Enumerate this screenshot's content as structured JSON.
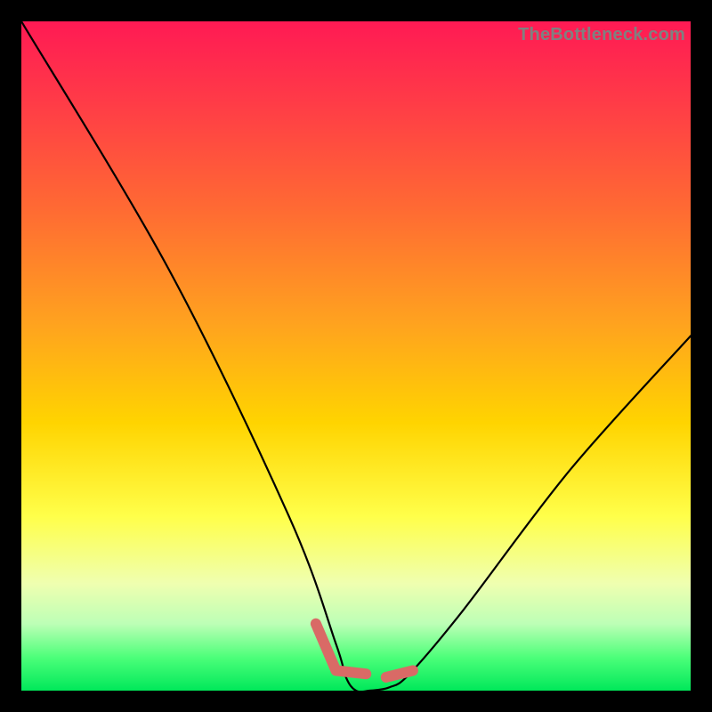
{
  "attribution": "TheBottleneck.com",
  "chart_data": {
    "type": "line",
    "title": "",
    "xlabel": "",
    "ylabel": "",
    "xlim": [
      0,
      100
    ],
    "ylim": [
      0,
      100
    ],
    "series": [
      {
        "name": "curve",
        "values": [
          {
            "x": 0.0,
            "y": 100.0
          },
          {
            "x": 22.0,
            "y": 63.0
          },
          {
            "x": 40.0,
            "y": 26.0
          },
          {
            "x": 47.0,
            "y": 7.0
          },
          {
            "x": 48.5,
            "y": 2.0
          },
          {
            "x": 50.0,
            "y": 0.0
          },
          {
            "x": 52.0,
            "y": 0.0
          },
          {
            "x": 55.0,
            "y": 0.5
          },
          {
            "x": 58.0,
            "y": 2.5
          },
          {
            "x": 66.0,
            "y": 12.0
          },
          {
            "x": 82.0,
            "y": 33.0
          },
          {
            "x": 100.0,
            "y": 53.0
          }
        ]
      },
      {
        "name": "left-marker-dash",
        "values": [
          {
            "x": 44.0,
            "y": 10.0
          },
          {
            "x": 47.0,
            "y": 3.0
          },
          {
            "x": 51.5,
            "y": 2.5
          }
        ]
      },
      {
        "name": "right-marker-dash",
        "values": [
          {
            "x": 54.5,
            "y": 2.0
          },
          {
            "x": 58.5,
            "y": 3.0
          }
        ]
      }
    ],
    "colors": {
      "curve": "#000000",
      "marker": "#d96a66"
    }
  }
}
